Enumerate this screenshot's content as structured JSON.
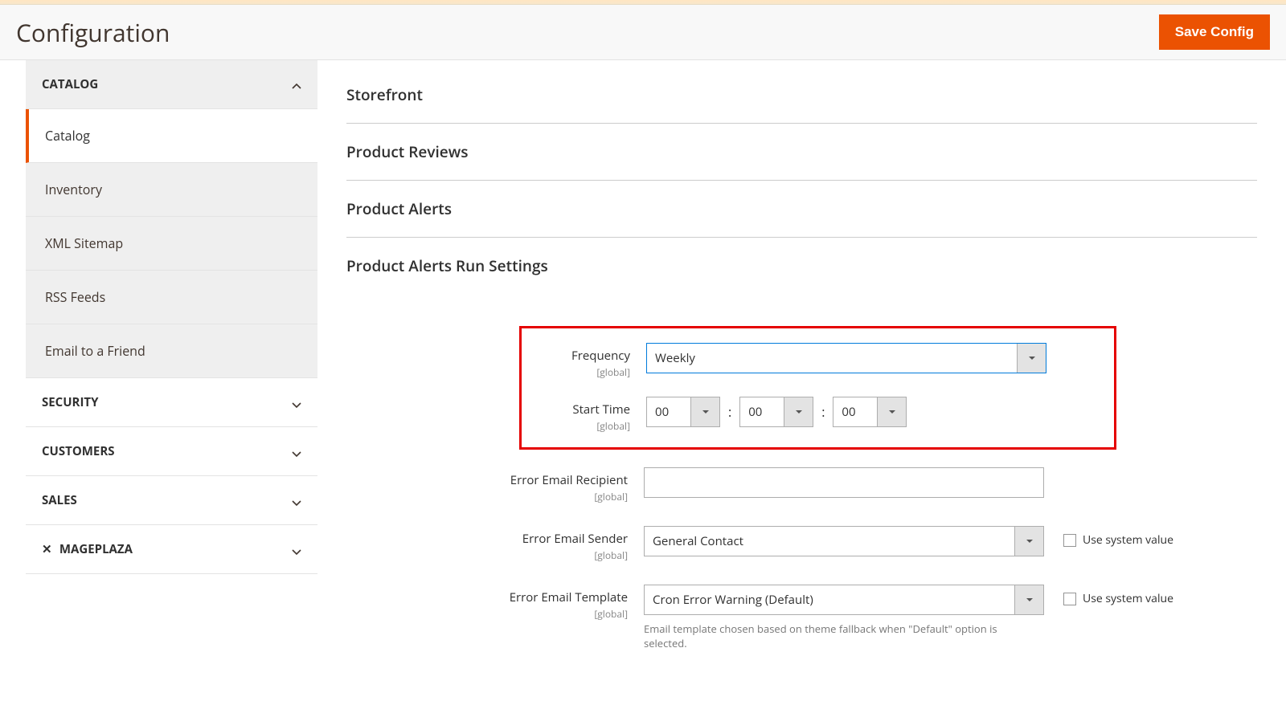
{
  "header": {
    "title": "Configuration",
    "save_label": "Save Config"
  },
  "sidebar": {
    "sections": [
      {
        "label": "CATALOG",
        "expanded": true,
        "items": [
          {
            "label": "Catalog",
            "active": true
          },
          {
            "label": "Inventory",
            "active": false
          },
          {
            "label": "XML Sitemap",
            "active": false
          },
          {
            "label": "RSS Feeds",
            "active": false
          },
          {
            "label": "Email to a Friend",
            "active": false
          }
        ]
      },
      {
        "label": "SECURITY",
        "expanded": false
      },
      {
        "label": "CUSTOMERS",
        "expanded": false
      },
      {
        "label": "SALES",
        "expanded": false
      },
      {
        "label": "MAGEPLAZA",
        "expanded": false,
        "icon": "mageplaza"
      }
    ]
  },
  "main": {
    "accordions": [
      {
        "label": "Storefront"
      },
      {
        "label": "Product Reviews"
      },
      {
        "label": "Product Alerts"
      },
      {
        "label": "Product Alerts Run Settings"
      }
    ],
    "fields": {
      "frequency": {
        "label": "Frequency",
        "scope": "[global]",
        "value": "Weekly"
      },
      "start_time": {
        "label": "Start Time",
        "scope": "[global]",
        "h": "00",
        "m": "00",
        "s": "00"
      },
      "error_recipient": {
        "label": "Error Email Recipient",
        "scope": "[global]",
        "value": ""
      },
      "error_sender": {
        "label": "Error Email Sender",
        "scope": "[global]",
        "value": "General Contact",
        "use_system_label": "Use system value"
      },
      "error_template": {
        "label": "Error Email Template",
        "scope": "[global]",
        "value": "Cron Error Warning (Default)",
        "use_system_label": "Use system value",
        "hint": "Email template chosen based on theme fallback when \"Default\" option is selected."
      }
    },
    "colon": ":"
  }
}
